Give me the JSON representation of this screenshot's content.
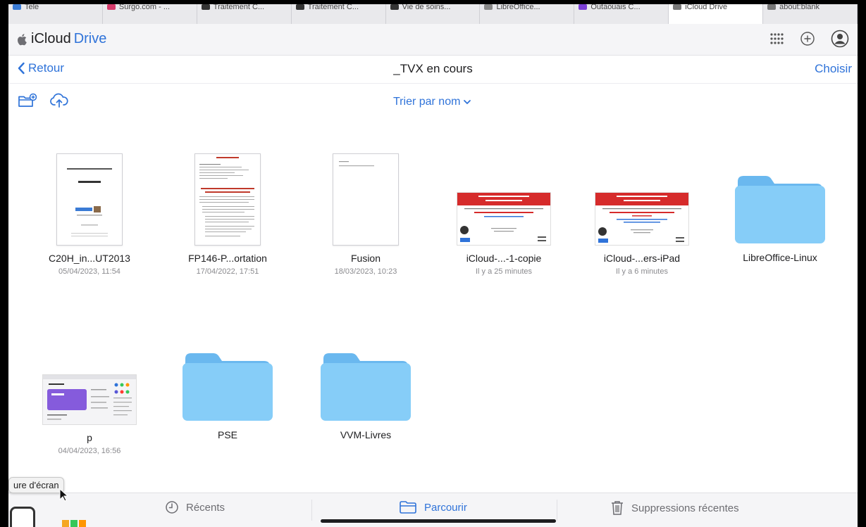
{
  "browser_tabs": [
    {
      "label": "Tele",
      "color": "#3a7bd5"
    },
    {
      "label": "Surgo.com - ...",
      "color": "#d63b6b"
    },
    {
      "label": "Traitement C...",
      "color": "#333333"
    },
    {
      "label": "Traitement C...",
      "color": "#333333"
    },
    {
      "label": "Vie de soins...",
      "color": "#333333"
    },
    {
      "label": "LibreOffice...",
      "color": "#888888"
    },
    {
      "label": "Outaouais C...",
      "color": "#7b3fd6"
    },
    {
      "label": "iCloud Drive",
      "color": "#777777",
      "active": true
    },
    {
      "label": "about:blank",
      "color": "#777777"
    }
  ],
  "app": {
    "brand_prefix": "iCloud",
    "brand_suffix": "Drive",
    "icons": [
      "apps-grid-icon",
      "add-circle-icon",
      "account-icon"
    ]
  },
  "nav": {
    "back_label": "Retour",
    "title": "_TVX en cours",
    "choose_label": "Choisir"
  },
  "toolbar": {
    "sort_label": "Trier par nom",
    "icons": [
      "new-folder-icon",
      "upload-icon"
    ]
  },
  "items": [
    {
      "name": "C20H_in...UT2013",
      "date": "05/04/2023, 11:54",
      "kind": "doc"
    },
    {
      "name": "FP146-P...ortation",
      "date": "17/04/2022, 17:51",
      "kind": "doc"
    },
    {
      "name": "Fusion",
      "date": "18/03/2023, 10:23",
      "kind": "doc"
    },
    {
      "name": "iCloud-...-1-copie",
      "date": "Il y a 25 minutes",
      "kind": "slide"
    },
    {
      "name": "iCloud-...ers-iPad",
      "date": "Il y a 6 minutes",
      "kind": "slide"
    },
    {
      "name": "LibreOffice-Linux",
      "date": "",
      "kind": "folder"
    },
    {
      "name": "p",
      "date": "04/04/2023, 16:56",
      "kind": "screenshot"
    },
    {
      "name": "PSE",
      "date": "",
      "kind": "folder"
    },
    {
      "name": "VVM-Livres",
      "date": "",
      "kind": "folder"
    }
  ],
  "bottom_tabs": [
    {
      "label": "Récents",
      "icon": "clock-icon"
    },
    {
      "label": "Parcourir",
      "icon": "folder-icon",
      "active": true
    },
    {
      "label": "Suppressions récentes",
      "icon": "trash-icon"
    }
  ],
  "tooltip": "ure d'écran",
  "colors": {
    "accent": "#2f73d9",
    "folder": "#7cc7f5"
  }
}
